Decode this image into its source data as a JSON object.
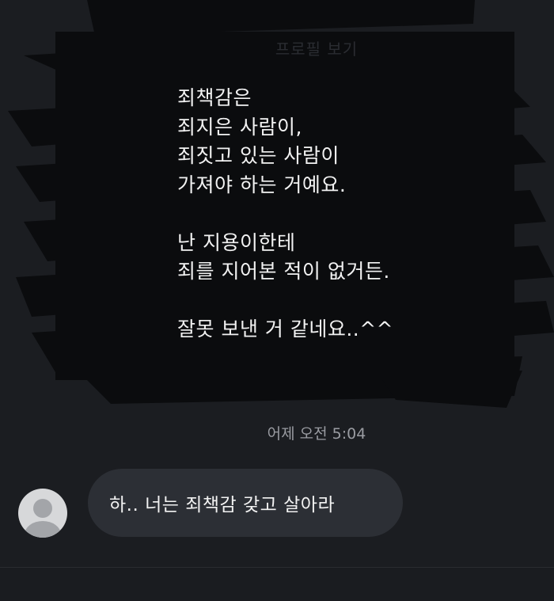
{
  "header": {
    "profile_link": "프로필 보기"
  },
  "message": {
    "lines": "죄책감은\n죄지은 사람이,\n죄짓고 있는 사람이\n가져야 하는 거예요.\n\n난 지용이한테\n죄를 지어본 적이 없거든.\n\n잘못 보낸 거 같네요..^^"
  },
  "timestamp": "어제 오전 5:04",
  "reply": {
    "text": "하.. 너는 죄책감 갖고 살아라"
  },
  "colors": {
    "background": "#1b1d21",
    "bubble": "#2c2f35",
    "scribble": "#0b0c0e"
  }
}
